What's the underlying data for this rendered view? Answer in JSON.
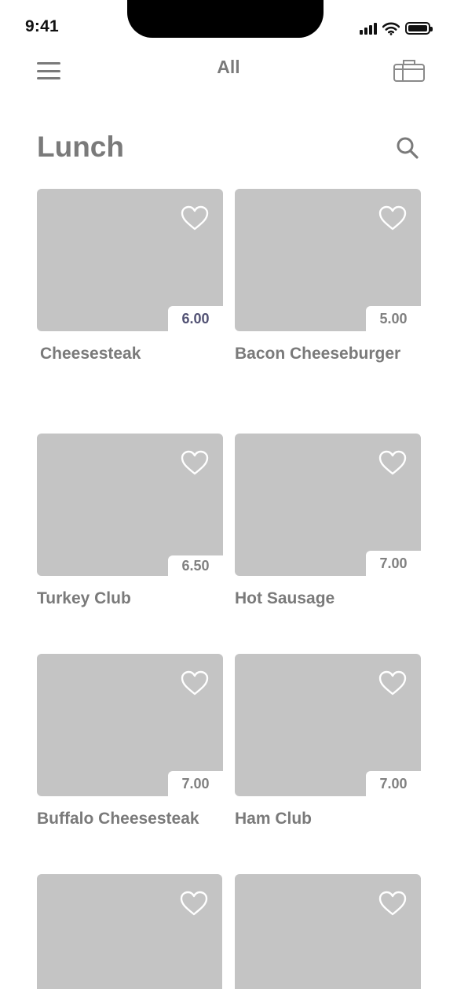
{
  "status_bar": {
    "time": "9:41"
  },
  "nav": {
    "title": "All"
  },
  "section": {
    "title": "Lunch"
  },
  "colors": {
    "placeholder": "#c4c4c4",
    "text": "#7a7a7a",
    "price_accent": "#525274"
  },
  "products": [
    {
      "name": "Cheesesteak",
      "price": "6.00"
    },
    {
      "name": "Bacon Cheeseburger",
      "price": "5.00"
    },
    {
      "name": "Turkey Club",
      "price": "6.50"
    },
    {
      "name": "Hot Sausage",
      "price": "7.00"
    },
    {
      "name": "Buffalo Cheesesteak",
      "price": "7.00"
    },
    {
      "name": "Ham Club",
      "price": "7.00"
    }
  ]
}
